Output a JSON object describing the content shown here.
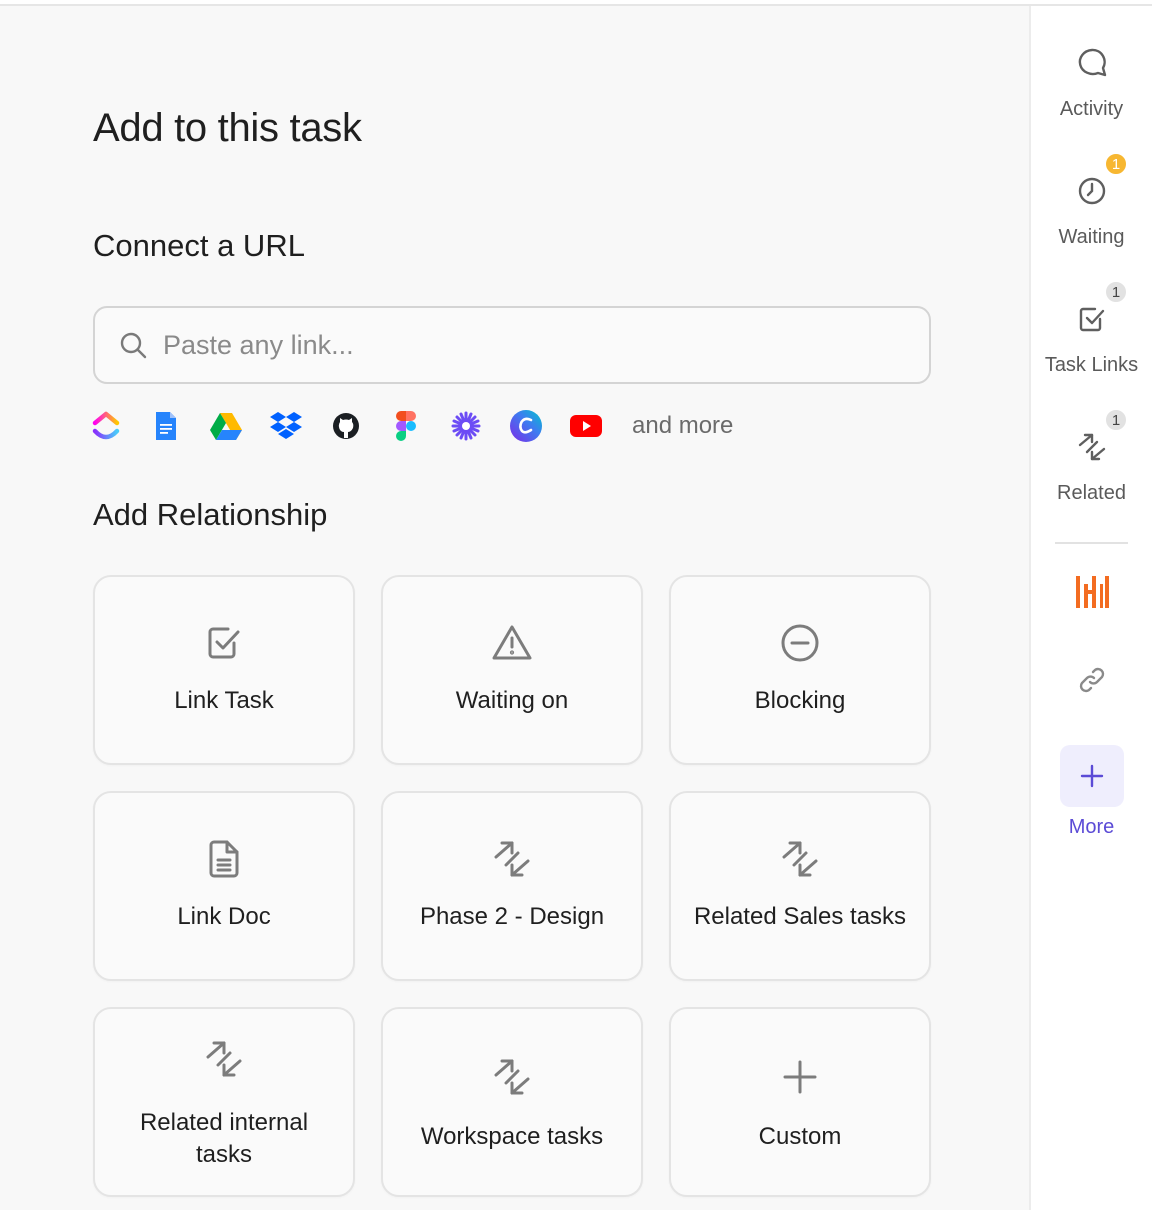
{
  "main": {
    "title": "Add to this task",
    "connect_url": {
      "heading": "Connect a URL",
      "placeholder": "Paste any link...",
      "integrations": [
        "clickup-icon",
        "google-docs-icon",
        "google-drive-icon",
        "dropbox-icon",
        "github-icon",
        "figma-icon",
        "asterisk-app-icon",
        "canva-icon",
        "youtube-icon"
      ],
      "and_more": "and more"
    },
    "relationship": {
      "heading": "Add Relationship",
      "cards": [
        {
          "label": "Link Task",
          "icon": "checkbox-icon"
        },
        {
          "label": "Waiting on",
          "icon": "warning-icon"
        },
        {
          "label": "Blocking",
          "icon": "minus-circle-icon"
        },
        {
          "label": "Link Doc",
          "icon": "document-icon"
        },
        {
          "label": "Phase 2 - Design",
          "icon": "relationship-arrows-icon"
        },
        {
          "label": "Related Sales tasks",
          "icon": "relationship-arrows-icon"
        },
        {
          "label": "Related internal tasks",
          "icon": "relationship-arrows-icon"
        },
        {
          "label": "Workspace tasks",
          "icon": "relationship-arrows-icon"
        },
        {
          "label": "Custom",
          "icon": "plus-icon"
        }
      ]
    }
  },
  "sidebar": {
    "items": [
      {
        "label": "Activity",
        "icon": "chat-bubble-icon"
      },
      {
        "label": "Waiting",
        "icon": "clock-icon",
        "badge": "1",
        "badge_color": "#f7b731"
      },
      {
        "label": "Task Links",
        "icon": "checkbox-icon",
        "badge": "1"
      },
      {
        "label": "Related",
        "icon": "relationship-arrows-icon",
        "badge": "1"
      }
    ],
    "apps": [
      {
        "icon": "harvest-app-icon",
        "color": "#f36c21"
      },
      {
        "icon": "link-icon"
      }
    ],
    "more_label": "More",
    "accent": "#5b4bd6"
  }
}
